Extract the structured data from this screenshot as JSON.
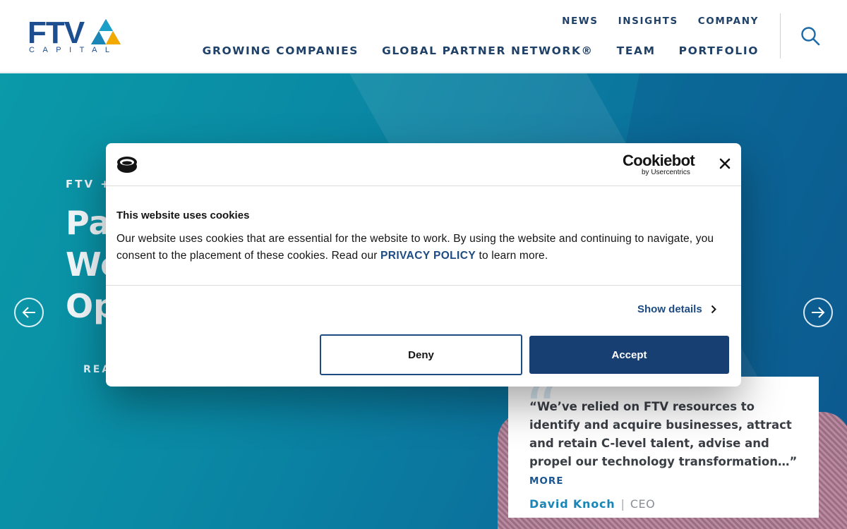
{
  "logo": {
    "letters": "FTV",
    "sub": "CAPITAL"
  },
  "nav": {
    "top": [
      "NEWS",
      "INSIGHTS",
      "COMPANY"
    ],
    "bottom": [
      "GROWING COMPANIES",
      "GLOBAL PARTNER NETWORK®",
      "TEAM",
      "PORTFOLIO"
    ],
    "search_icon": "search-icon"
  },
  "hero": {
    "eyebrow": "FTV +",
    "headline_lines": [
      "Pa",
      "We",
      "Op"
    ],
    "cta": "REA"
  },
  "quote": {
    "text": "“We’ve relied on FTV resources to identify and acquire businesses, attract and retain C-level talent, advise and propel our technology transformation…”",
    "more": "MORE",
    "author": "David Knoch",
    "separator": "|",
    "role": "CEO"
  },
  "cookie": {
    "brand": "Cookiebot",
    "brand_sub": "by Usercentrics",
    "title": "This website uses cookies",
    "body_before": "Our website uses cookies that are essential for the website to work.  By using the website and continuing to navigate, you consent to the placement of these cookies.  Read our ",
    "link": "PRIVACY POLICY",
    "body_after": " to learn more.",
    "show_details": "Show details",
    "deny": "Deny",
    "accept": "Accept"
  },
  "colors": {
    "brand": "#1d4e8f",
    "accept": "#183f72",
    "hero_teal": "#0a88a4",
    "author": "#1a86b8"
  }
}
